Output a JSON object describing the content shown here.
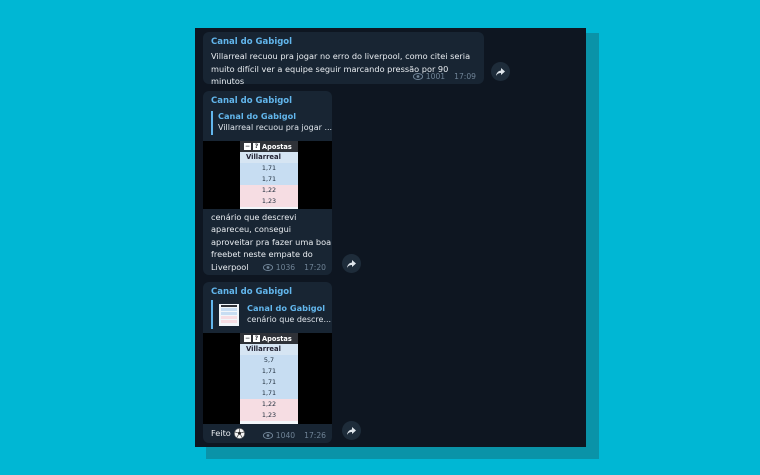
{
  "colors": {
    "background": "#00b7d4",
    "chat_bg": "#0e1621",
    "bubble": "#182533",
    "sender": "#62b6ec",
    "meta": "#6f8396"
  },
  "messages": [
    {
      "sender": "Canal do Gabigol",
      "text": "Villarreal recuou pra jogar no erro do liverpool, como citei seria muito difícil ver a equipe seguir marcando pressão por 90 minutos",
      "views": "1001",
      "time": "17:09"
    },
    {
      "sender": "Canal do Gabigol",
      "reply": {
        "name": "Canal do Gabigol",
        "text": "Villarreal recuou pra jogar ..."
      },
      "image": {
        "header_icons": [
          "−",
          "?"
        ],
        "title": "Apostas",
        "team": "Villarreal",
        "odds": [
          "1,71",
          "1,71",
          "1,22",
          "1,23"
        ]
      },
      "text_lines": [
        "cenário que descrevi",
        "apareceu, consegui",
        "aproveitar pra fazer uma boa",
        "freebet neste empate do",
        "Liverpool"
      ],
      "views": "1036",
      "time": "17:20"
    },
    {
      "sender": "Canal do Gabigol",
      "reply": {
        "name": "Canal do Gabigol",
        "text": "cenário que descre..."
      },
      "image": {
        "header_icons": [
          "−",
          "?"
        ],
        "title": "Apostas",
        "team": "Villarreal",
        "odds": [
          "5,7",
          "1,71",
          "1,71",
          "1,71",
          "1,22",
          "1,23"
        ]
      },
      "text": "Feito",
      "emoji": "soccer-ball",
      "views": "1040",
      "time": "17:26"
    }
  ]
}
